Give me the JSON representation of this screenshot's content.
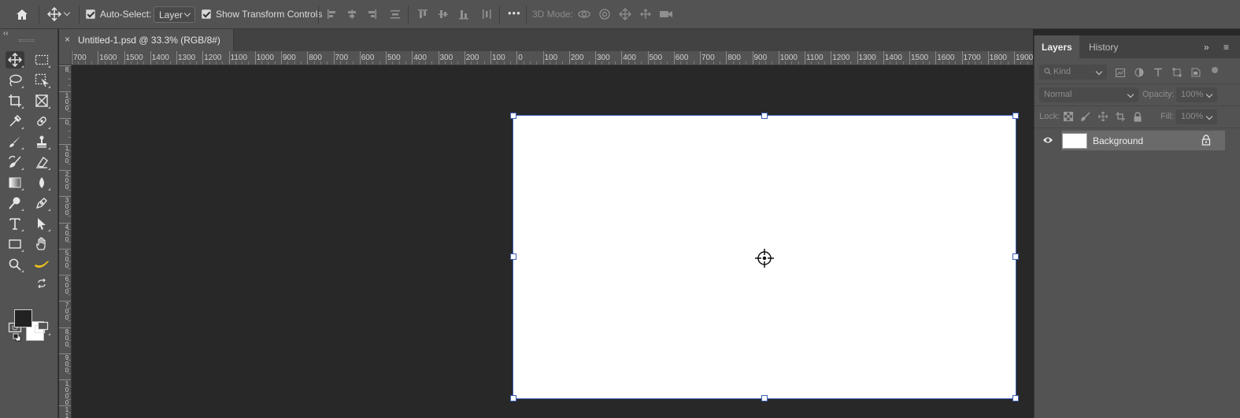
{
  "options_bar": {
    "auto_select_label": "Auto-Select:",
    "auto_select_checked": true,
    "auto_select_target": "Layer",
    "transform_label": "Show Transform Controls",
    "transform_checked": true,
    "more_label": "•••",
    "mode_3d_label": "3D Mode:"
  },
  "document_tab": {
    "close_label": "×",
    "title": "Untitled-1.psd @ 33.3% (RGB/8#)"
  },
  "toolbar": {
    "collapse_label": "‹‹"
  },
  "ruler_top": {
    "labels": [
      "700",
      "1600",
      "1500",
      "1400",
      "1300",
      "1200",
      "1100",
      "1000",
      "900",
      "800",
      "700",
      "600",
      "500",
      "400",
      "300",
      "200",
      "100",
      "0",
      "100",
      "200",
      "300",
      "400",
      "500",
      "600",
      "700",
      "800",
      "900",
      "1000",
      "1100",
      "1200",
      "1300",
      "1400",
      "1500",
      "1600",
      "1700",
      "1800",
      "1900"
    ]
  },
  "ruler_left": {
    "labels": [
      "8",
      "1 0 0",
      "0",
      "1 0 0",
      "2 0 0",
      "3 0 0",
      "4 0 0",
      "5 0 0",
      "6 0 0",
      "7 0 0",
      "8 0 0",
      "9 0 0",
      "1 0 0 0",
      "1 1"
    ]
  },
  "panel": {
    "tabs": [
      "Layers",
      "History"
    ],
    "active_tab": "Layers",
    "expand_label": "»",
    "menu_label": "≡",
    "kind_placeholder": "Kind",
    "blend_mode": "Normal",
    "opacity_label": "Opacity:",
    "opacity_value": "100%",
    "lock_label": "Lock:",
    "fill_label": "Fill:",
    "fill_value": "100%",
    "layers": [
      {
        "name": "Background",
        "visible": true,
        "locked": true
      }
    ]
  },
  "colors": {
    "foreground": "#222222",
    "background": "#ffffff",
    "selection_accent": "#3b5fb3"
  }
}
